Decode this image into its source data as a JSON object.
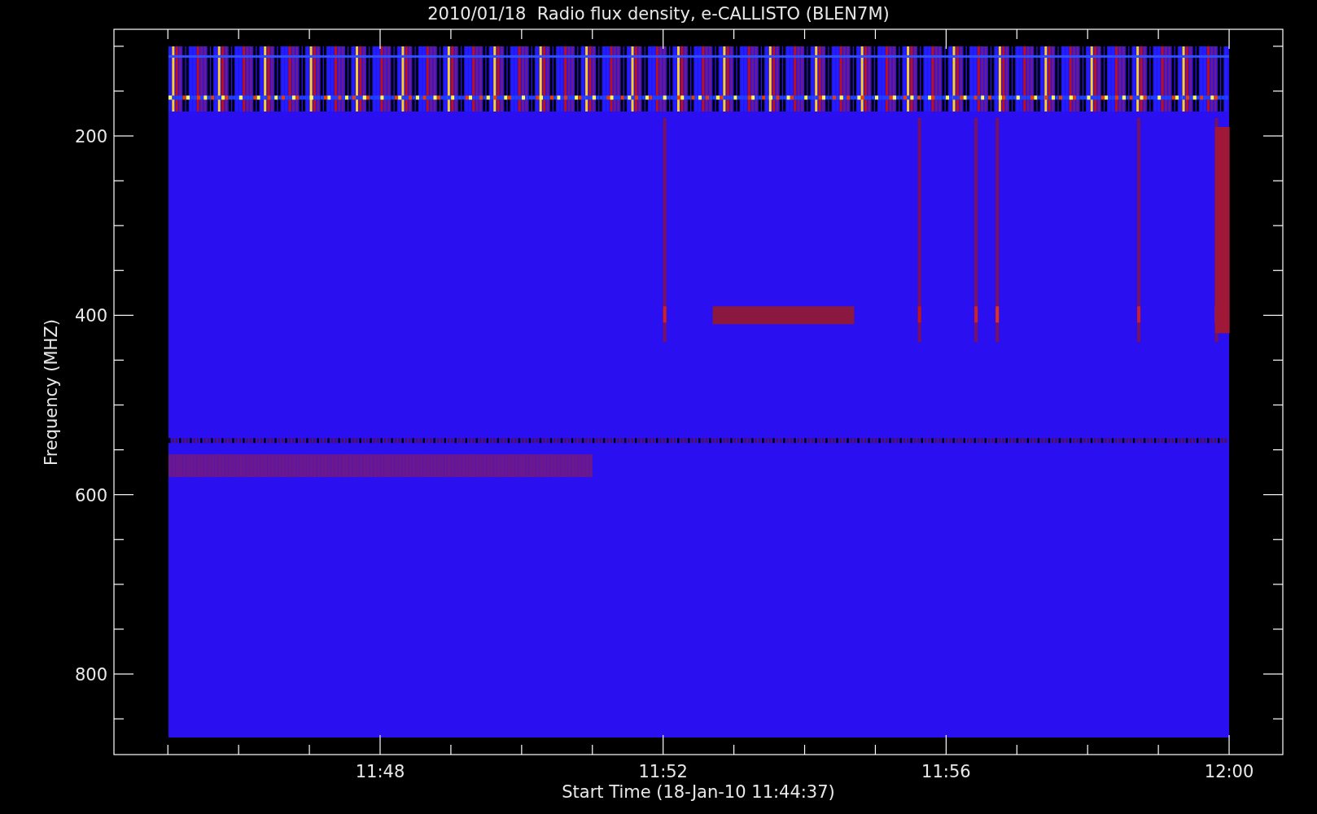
{
  "plot": {
    "title": "2010/01/18  Radio flux density, e-CALLISTO (BLEN7M)",
    "xlabel": "Start Time (18-Jan-10 11:44:37)",
    "ylabel": "Frequency (MHZ)",
    "x_tick_labels": [
      "11:48",
      "11:52",
      "11:56",
      "12:00"
    ],
    "y_tick_labels": [
      "200",
      "400",
      "600",
      "800"
    ]
  }
}
